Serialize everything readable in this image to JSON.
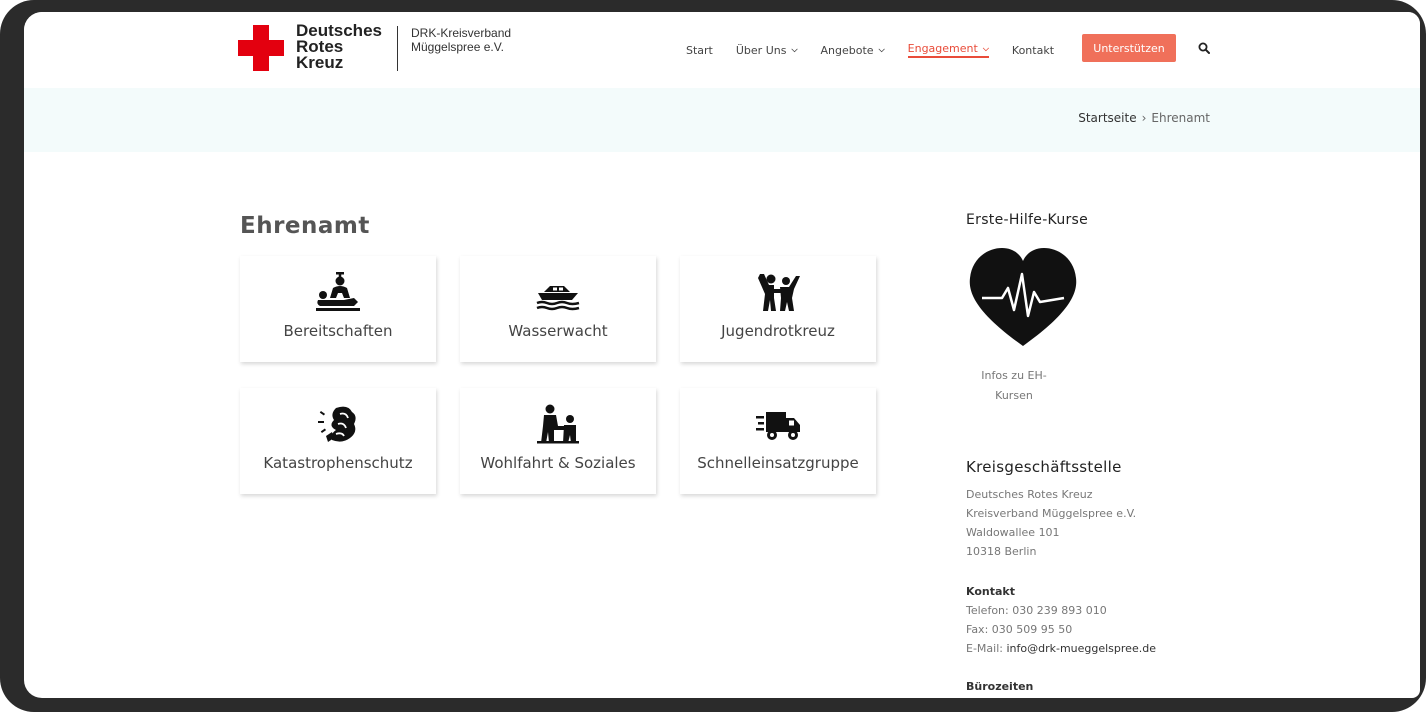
{
  "logo": {
    "lines": [
      "Deutsches",
      "Rotes",
      "Kreuz"
    ],
    "sub_lines": [
      "DRK-Kreisverband",
      "Müggelspree e.V."
    ]
  },
  "nav": {
    "items": [
      {
        "label": "Start",
        "has_dropdown": false,
        "active": false
      },
      {
        "label": "Über Uns",
        "has_dropdown": true,
        "active": false
      },
      {
        "label": "Angebote",
        "has_dropdown": true,
        "active": false
      },
      {
        "label": "Engagement",
        "has_dropdown": true,
        "active": true
      },
      {
        "label": "Kontakt",
        "has_dropdown": false,
        "active": false
      }
    ],
    "support_label": "Unterstützen",
    "accent_color": "#f0705a"
  },
  "breadcrumb": {
    "home": "Startseite",
    "separator": "›",
    "current": "Ehrenamt"
  },
  "main": {
    "title": "Ehrenamt",
    "cards": [
      {
        "label": "Bereitschaften",
        "icon": "first-aid-rescuer-icon"
      },
      {
        "label": "Wasserwacht",
        "icon": "boat-icon"
      },
      {
        "label": "Jugendrotkreuz",
        "icon": "children-icon"
      },
      {
        "label": "Katastrophenschutz",
        "icon": "disaster-icon"
      },
      {
        "label": "Wohlfahrt & Soziales",
        "icon": "helping-hand-icon"
      },
      {
        "label": "Schnelleinsatzgruppe",
        "icon": "delivery-truck-icon"
      }
    ]
  },
  "sidebar": {
    "first_aid_title": "Erste-Hilfe-Kurse",
    "first_aid_icon": "heartbeat-icon",
    "first_aid_link": [
      "Infos zu EH-",
      "Kursen"
    ],
    "office_title": "Kreisgeschäftsstelle",
    "address": [
      "Deutsches Rotes Kreuz",
      "Kreisverband Müggelspree e.V.",
      "Waldowallee 101",
      "10318 Berlin"
    ],
    "contact_title": "Kontakt",
    "phone": "Telefon: 030 239 893 010",
    "fax": "Fax: 030 509 95 50",
    "email_prefix": "E-Mail: ",
    "email": "info@drk-mueggelspree.de",
    "hours_title": "Bürozeiten"
  }
}
